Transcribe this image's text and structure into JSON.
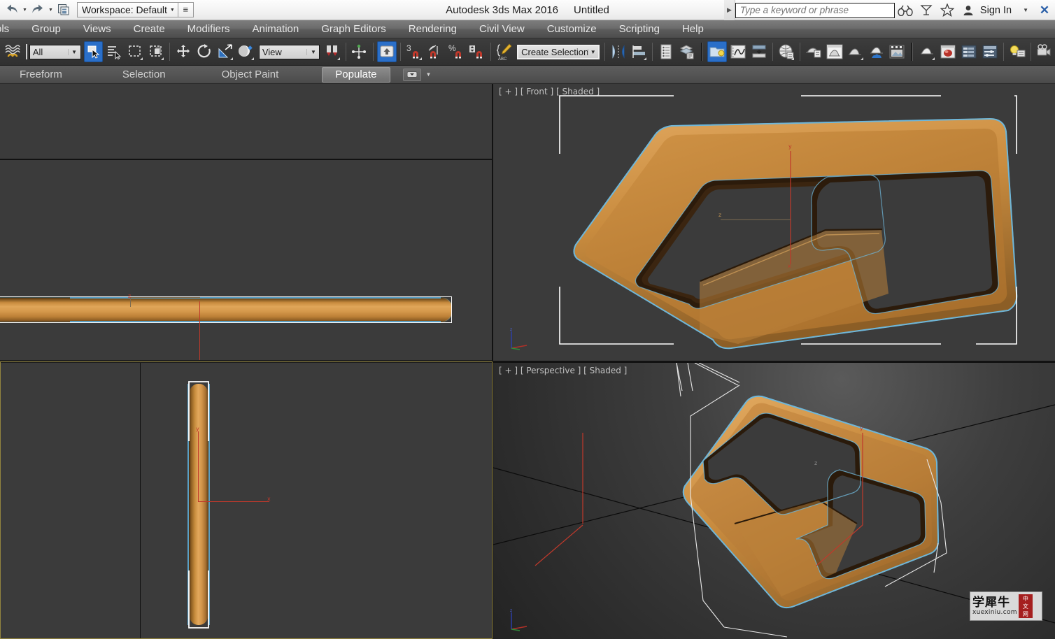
{
  "app": {
    "title": "Autodesk 3ds Max 2016",
    "document": "Untitled"
  },
  "titlebar": {
    "undo_icon": "undo-icon",
    "redo_icon": "redo-icon",
    "save_icon": "save-icon",
    "workspace_label": "Workspace: Default",
    "workspace_dropdown_icon": "chevron-down-icon",
    "workspace_menu_icon": "menu-icon",
    "expand_icon": "chevron-right-icon",
    "search_placeholder": "Type a keyword or phrase",
    "search_value": "",
    "help_search_icon": "binoculars-icon",
    "communication_icon": "satellite-dish-icon",
    "favorites_icon": "star-icon",
    "account_icon": "person-icon",
    "signin_label": "Sign In",
    "signin_caret_icon": "chevron-down-icon",
    "close_icon": "close-icon"
  },
  "menubar": {
    "items": [
      {
        "label": "ols"
      },
      {
        "label": "Group"
      },
      {
        "label": "Views"
      },
      {
        "label": "Create"
      },
      {
        "label": "Modifiers"
      },
      {
        "label": "Animation"
      },
      {
        "label": "Graph Editors"
      },
      {
        "label": "Rendering"
      },
      {
        "label": "Civil View"
      },
      {
        "label": "Customize"
      },
      {
        "label": "Scripting"
      },
      {
        "label": "Help"
      }
    ]
  },
  "toolbar": {
    "snaps_toggle_icon": "curve-snap-icon",
    "selection_filter_value": "All",
    "selection_filter_caret": "chevron-down-icon",
    "select_object_icon": "select-object-icon",
    "select_by_name_icon": "select-by-name-icon",
    "rect_selection_region_icon": "rectangular-selection-region-icon",
    "window_crossing_icon": "window-crossing-icon",
    "select_move_icon": "select-and-move-icon",
    "select_rotate_icon": "select-and-rotate-icon",
    "select_scale_icon": "select-and-uniform-scale-icon",
    "ref_coord_icon": "reference-coordinate-icon",
    "ref_coord_value": "View",
    "ref_coord_caret": "chevron-down-icon",
    "pivot_icon": "use-pivot-point-center-icon",
    "selection_link_icon": "select-and-link-icon",
    "named_selection_icon": "named-selection-sets-icon",
    "snap_toggle_3_icon": "snaps-toggle-3-icon",
    "angle_snap_icon": "angle-snap-toggle-icon",
    "percent_snap_icon": "percent-snap-toggle-icon",
    "spinner_snap_icon": "spinner-snap-toggle-icon",
    "edit_named_sets_icon": "edit-named-selection-sets-icon",
    "selection_set_value": "Create Selection Se",
    "selection_set_caret": "chevron-down-icon",
    "mirror_icon": "mirror-icon",
    "align_icon": "align-icon",
    "layer_explorer_icon": "layer-explorer-icon",
    "layer_manager_icon": "layer-manager-icon",
    "toggle_ribbon_icon": "toggle-ribbon-icon",
    "curve_editor_icon": "curve-editor-icon",
    "schematic_view_icon": "schematic-view-icon",
    "material_editor_icon": "material-editor-icon",
    "material_browser_icon": "material-explorer-icon",
    "render_setup_icon": "render-setup-icon",
    "rendered_frame_icon": "rendered-frame-window-icon",
    "render_production_icon": "render-production-icon",
    "render_iterative_icon": "render-iterative-icon",
    "activeshade_icon": "activeshade-icon",
    "render_preview_icon": "render-preview-icon",
    "render_image_icon": "render-image-icon",
    "state_sets_icon": "state-sets-icon",
    "scene_converter_icon": "scene-converter-icon",
    "light_icon": "light-explorer-icon",
    "camera_icon": "camera-sequencer-icon"
  },
  "ribbon": {
    "tabs": [
      {
        "label": "Freeform",
        "selected": false
      },
      {
        "label": "Selection",
        "selected": false
      },
      {
        "label": "Object Paint",
        "selected": false
      },
      {
        "label": "Populate",
        "selected": true
      }
    ],
    "minimize_icon": "minimize-ribbon-icon",
    "caret_icon": "chevron-down-icon"
  },
  "viewports": [
    {
      "name": "top-left",
      "label": "",
      "active": false
    },
    {
      "name": "left",
      "label": "",
      "active": false
    },
    {
      "name": "front",
      "label": "[ + ] [ Front ] [ Shaded ]",
      "active": false
    },
    {
      "name": "bottom-left",
      "label": "",
      "active": true
    },
    {
      "name": "perspective",
      "label": "[ + ] [ Perspective ] [ Shaded ]",
      "active": false
    }
  ],
  "axis_labels": {
    "x": "x",
    "y": "y",
    "z": "z"
  },
  "colors": {
    "accent_blue": "#2a6fc9",
    "model_orange": "#d49347",
    "selection_cyan": "#5a9fc4",
    "axis_red": "#c0392b",
    "active_viewport_border": "#93853f",
    "viewport_bg": "#3b3b3b",
    "toolbar_bg": "#363636",
    "menubar_bg": "#6c6c6c",
    "titlebar_bg": "#f3f3f3"
  },
  "watermark": {
    "chinese": "学犀牛",
    "site": "xuexiniu.com",
    "badge_line1": "中",
    "badge_line2": "文",
    "badge_line3": "网"
  }
}
